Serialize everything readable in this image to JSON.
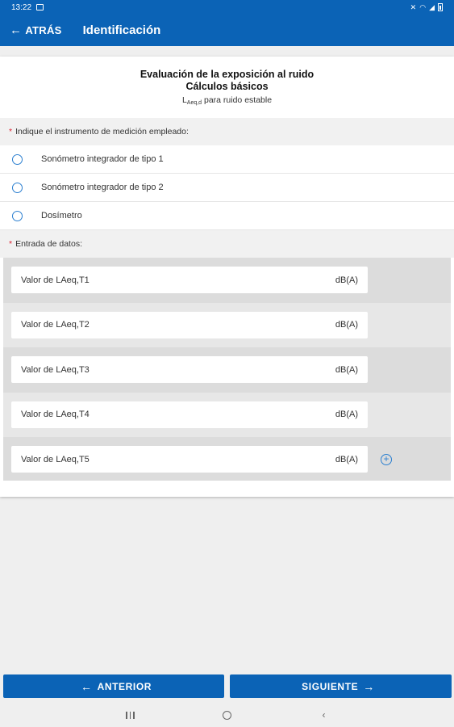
{
  "status": {
    "time": "13:22"
  },
  "appbar": {
    "back_label": "ATRÁS",
    "title": "Identificación"
  },
  "header": {
    "title_line1": "Evaluación de la exposición al ruido",
    "title_line2": "Cálculos básicos",
    "sub_main": "L",
    "sub_subscript": "Aeq,d",
    "sub_rest": " para ruido estable"
  },
  "instrument": {
    "required_mark": "*",
    "label": "Indique el instrumento de medición empleado:",
    "options": [
      {
        "label": "Sonómetro integrador de tipo 1",
        "selected": false
      },
      {
        "label": "Sonómetro integrador de tipo 2",
        "selected": false
      },
      {
        "label": "Dosímetro",
        "selected": false
      }
    ]
  },
  "data_entry": {
    "required_mark": "*",
    "label": "Entrada de datos:",
    "rows": [
      {
        "label": "Valor de LAeq,T1",
        "unit": "dB(A)"
      },
      {
        "label": "Valor de LAeq,T2",
        "unit": "dB(A)"
      },
      {
        "label": "Valor de LAeq,T3",
        "unit": "dB(A)"
      },
      {
        "label": "Valor de LAeq,T4",
        "unit": "dB(A)"
      },
      {
        "label": "Valor de LAeq,T5",
        "unit": "dB(A)"
      }
    ],
    "add_icon": "plus-circle-icon"
  },
  "footer": {
    "prev_label": "ANTERIOR",
    "next_label": "SIGUIENTE"
  },
  "colors": {
    "primary": "#0b63b6",
    "accent": "#2b7fd0",
    "required": "#d23"
  }
}
